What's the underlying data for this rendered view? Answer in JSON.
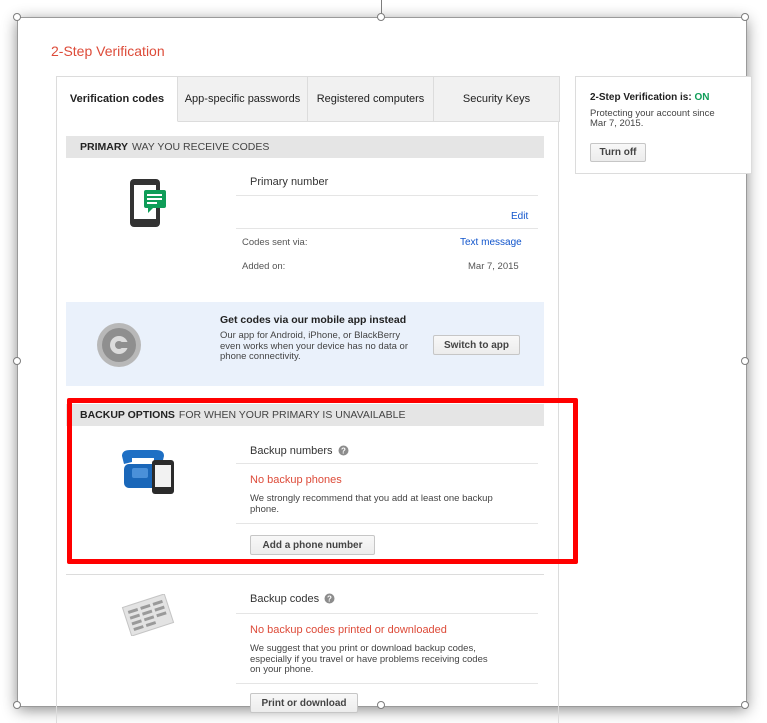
{
  "page_title": "2-Step Verification",
  "tabs": [
    {
      "label": "Verification codes"
    },
    {
      "label": "App-specific passwords"
    },
    {
      "label": "Registered computers"
    },
    {
      "label": "Security Keys"
    }
  ],
  "primary": {
    "heading_bold": "PRIMARY",
    "heading_rest": "WAY YOU RECEIVE CODES",
    "row_title": "Primary number",
    "edit_link": "Edit",
    "codes_sent_label": "Codes sent via:",
    "codes_sent_value": "Text message",
    "added_label": "Added on:",
    "added_value": "Mar 7, 2015"
  },
  "app_offer": {
    "title": "Get codes via our mobile app instead",
    "description": "Our app for Android, iPhone, or BlackBerry even works when your device has no data or phone connectivity.",
    "button": "Switch to app"
  },
  "backup": {
    "heading_bold": "BACKUP OPTIONS",
    "heading_rest": "FOR WHEN YOUR PRIMARY IS UNAVAILABLE",
    "numbers_title": "Backup numbers",
    "numbers_warning": "No backup phones",
    "numbers_desc": "We strongly recommend that you add at least one backup phone.",
    "add_button": "Add a phone number",
    "codes_title": "Backup codes",
    "codes_warning": "No backup codes printed or downloaded",
    "codes_desc": "We suggest that you print or download backup codes, especially if you travel or have problems receiving codes on your phone.",
    "print_button": "Print or download"
  },
  "sidebar": {
    "status_label": "2-Step Verification is:",
    "status_value": "ON",
    "status_desc": "Protecting your account since Mar 7, 2015.",
    "turn_off_button": "Turn off"
  },
  "colors": {
    "accent_red": "#dd4b39",
    "link_blue": "#1155cc",
    "status_green": "#0f9d58",
    "highlight_red": "#ff0000"
  },
  "icons": [
    "phone-sms-icon",
    "google-authenticator-icon",
    "backup-phones-icon",
    "help-icon",
    "backup-codes-icon"
  ]
}
